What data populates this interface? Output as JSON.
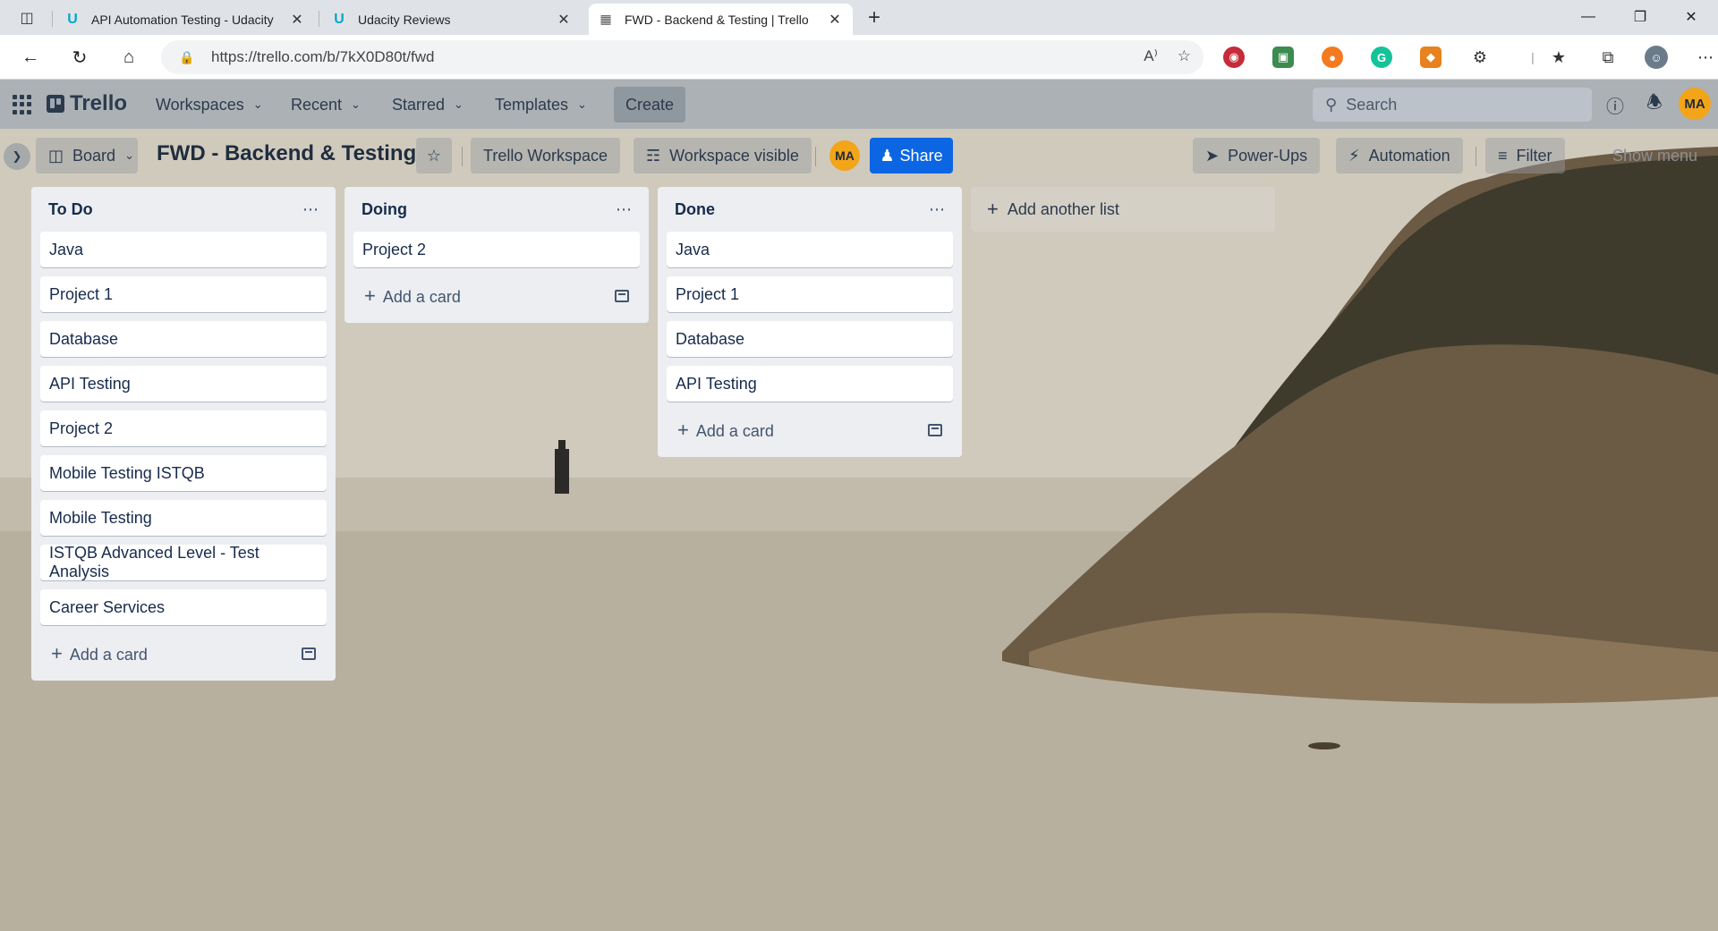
{
  "browser": {
    "tabs": [
      {
        "title": "API Automation Testing - Udacity",
        "favicon": "udacity-logo-icon",
        "active": false
      },
      {
        "title": "Udacity Reviews",
        "favicon": "udacity-logo-icon",
        "active": false
      },
      {
        "title": "FWD - Backend & Testing | Trello",
        "favicon": "trello-page-icon",
        "active": true
      }
    ],
    "url": "https://trello.com/b/7kX0D80t/fwd",
    "extensions": [
      "red-extension-icon",
      "green-extension-icon",
      "orange-extension-icon",
      "grammarly-icon",
      "metamask-icon",
      "extensions-icon"
    ],
    "profile": "profile-avatar"
  },
  "header": {
    "logo": "Trello",
    "nav": [
      {
        "label": "Workspaces"
      },
      {
        "label": "Recent"
      },
      {
        "label": "Starred"
      },
      {
        "label": "Templates"
      }
    ],
    "create_label": "Create",
    "search_placeholder": "Search",
    "avatar_initials": "MA"
  },
  "board": {
    "view_label": "Board",
    "title": "FWD - Backend & Testing",
    "workspace_label": "Trello Workspace",
    "visibility_label": "Workspace visible",
    "member_initials": "MA",
    "share_label": "Share",
    "powerups_label": "Power-Ups",
    "automation_label": "Automation",
    "filter_label": "Filter",
    "show_menu_label": "Show menu"
  },
  "lists": [
    {
      "title": "To Do",
      "cards": [
        "Java",
        "Project 1",
        "Database",
        "API Testing",
        "Project 2",
        "Mobile Testing ISTQB",
        "Mobile Testing",
        "ISTQB Advanced Level - Test Analysis",
        "Career Services"
      ],
      "add_card_label": "Add a card"
    },
    {
      "title": "Doing",
      "cards": [
        "Project 2"
      ],
      "add_card_label": "Add a card"
    },
    {
      "title": "Done",
      "cards": [
        "Java",
        "Project 1",
        "Database",
        "API Testing"
      ],
      "add_card_label": "Add a card"
    }
  ],
  "add_list_label": "Add another list"
}
